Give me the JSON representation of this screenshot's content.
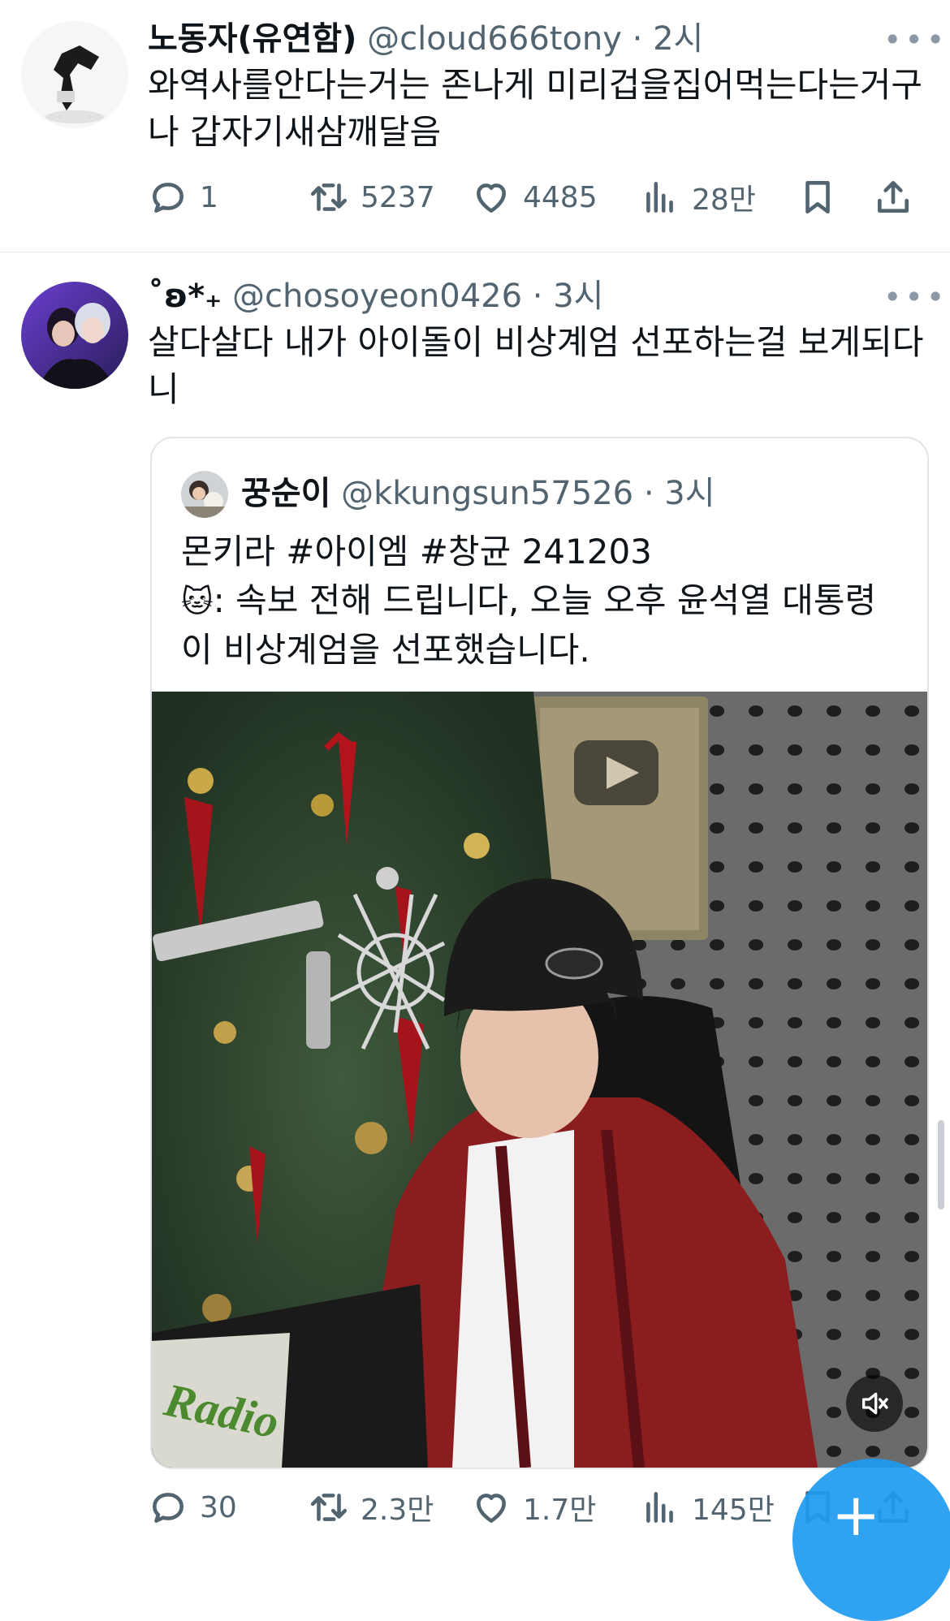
{
  "tweets": [
    {
      "name": "노동자(유연함)",
      "handle": "@cloud666tony",
      "time": "· 2시",
      "text_line1": "와역사를안다는거는 존나게 미리겁을집어먹는다는거구",
      "text_line2": "나 갑자기새삼깨달음",
      "replies": "1",
      "retweets": "5237",
      "likes": "4485",
      "views": "28만"
    },
    {
      "name": "˚ʚ*₊",
      "handle": "@chosoyeon0426",
      "time": "· 3시",
      "text_line1": "살다살다 내가 아이돌이 비상계엄 선포하는걸 보게되다",
      "text_line2": "니",
      "replies": "30",
      "retweets": "2.3만",
      "likes": "1.7만",
      "views": "145만",
      "quote": {
        "name": "꿍순이",
        "handle": "@kkungsun57526",
        "time": "· 3시",
        "line1": "몬키라 #아이엠 #창균 241203",
        "line2_emoji": "🐱",
        "line2": ": 속보 전해 드립니다, 오늘 오후 윤석열 대통령",
        "line3": "이 비상계엄을 선포했습니다."
      }
    }
  ],
  "video": {
    "sign_text": "Radio"
  },
  "icons": {
    "reply": "reply-icon",
    "retweet": "retweet-icon",
    "like": "heart-icon",
    "views": "views-chart-icon",
    "bookmark": "bookmark-icon",
    "share": "share-icon",
    "more": "more-dots-icon",
    "mute": "mute-icon",
    "compose": "compose-plus-icon"
  },
  "colors": {
    "text": "#0f1419",
    "secondary": "#536471",
    "accent": "#1d9bf0",
    "divider": "#e6e9eb"
  }
}
